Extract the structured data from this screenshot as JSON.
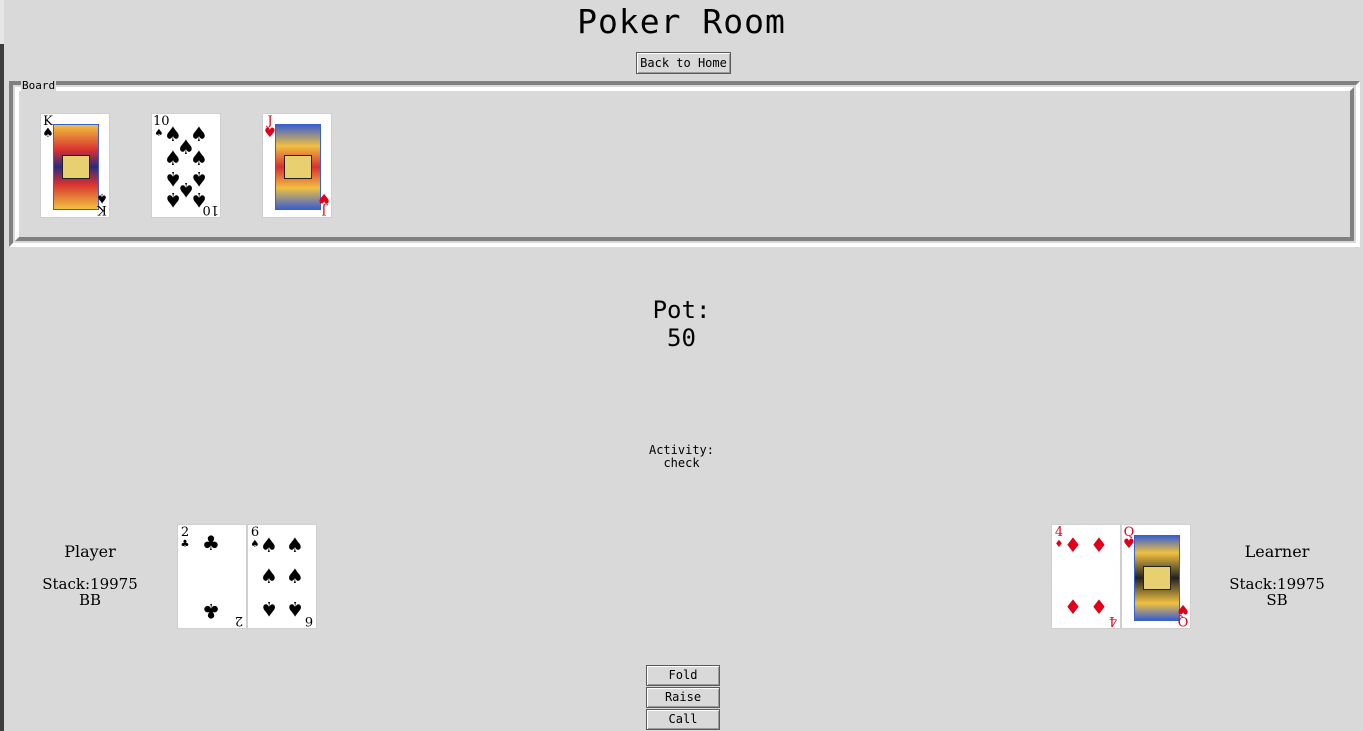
{
  "title": "Poker Room",
  "back_button_label": "Back to Home",
  "board": {
    "label": "Board",
    "cards": [
      {
        "rank": "K",
        "suit": "♠",
        "color": "black",
        "face": true
      },
      {
        "rank": "10",
        "suit": "♠",
        "color": "black",
        "face": false
      },
      {
        "rank": "J",
        "suit": "♥",
        "color": "red",
        "face": true
      }
    ]
  },
  "pot": {
    "label": "Pot:",
    "value": "50"
  },
  "activity": {
    "label": "Activity:",
    "value": "check"
  },
  "player": {
    "name": "Player",
    "stack": "Stack:19975",
    "position": "BB",
    "cards": [
      {
        "rank": "2",
        "suit": "♣",
        "color": "black",
        "face": false
      },
      {
        "rank": "6",
        "suit": "♠",
        "color": "black",
        "face": false
      }
    ]
  },
  "learner": {
    "name": "Learner",
    "stack": "Stack:19975",
    "position": "SB",
    "cards": [
      {
        "rank": "4",
        "suit": "♦",
        "color": "red",
        "face": false
      },
      {
        "rank": "Q",
        "suit": "♥",
        "color": "red",
        "face": true
      }
    ]
  },
  "actions": {
    "fold": "Fold",
    "raise": "Raise",
    "call": "Call"
  }
}
